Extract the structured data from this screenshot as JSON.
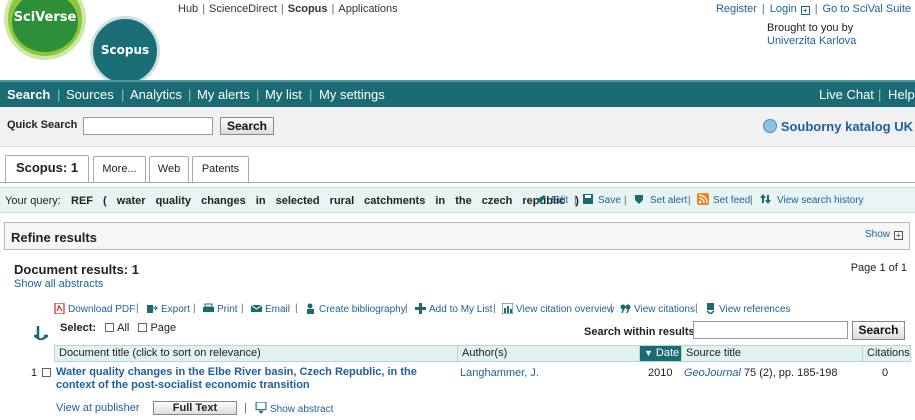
{
  "logos": {
    "sciverse": "SciVerse",
    "scopus": "Scopus"
  },
  "topnav": {
    "hub": "Hub",
    "sciencedirect": "ScienceDirect",
    "scopus": "Scopus",
    "applications": "Applications"
  },
  "toplinks": {
    "register": "Register",
    "login": "Login",
    "login_icon": "+",
    "scival": "Go to SciVal Suite"
  },
  "brought": {
    "line1": "Brought to you by",
    "line2": "Univerzita Karlova"
  },
  "mainnav": {
    "items": [
      "Search",
      "Sources",
      "Analytics",
      "My alerts",
      "My list",
      "My settings"
    ],
    "live_chat": "Live Chat",
    "help": "Help"
  },
  "quick_search": {
    "label": "Quick Search",
    "value": "",
    "button": "Search"
  },
  "katalog": "Souborny katalog UK",
  "tabs": [
    "Scopus: 1",
    "More...",
    "Web",
    "Patents"
  ],
  "query": {
    "label": "Your query:",
    "text": "REF ( water quality changes in selected rural catchments in the czech republic )",
    "edit": "Edit",
    "save": "Save",
    "set_alert": "Set alert",
    "set_feed": "Set feed",
    "history": "View search history"
  },
  "refine": {
    "title": "Refine results",
    "show": "Show",
    "show_icon": "+"
  },
  "results": {
    "title": "Document results: 1",
    "show_all": "Show all abstracts",
    "page": "Page  1 of 1"
  },
  "toolbar": {
    "download_pdf": "Download PDF",
    "export": "Export",
    "print": "Print",
    "email": "Email",
    "bibliography": "Create bibliography",
    "add_list": "Add to My List",
    "citation_overview": "View citation overview",
    "citations": "View citations",
    "references": "View references"
  },
  "select": {
    "label": "Select:",
    "all": "All",
    "page": "Page"
  },
  "search_within": {
    "label": "Search within results",
    "value": "",
    "button": "Search"
  },
  "table": {
    "headers": [
      "Document title (click to sort on relevance)",
      "Author(s)",
      "Date",
      "Source title",
      "Citations"
    ],
    "date_sort_icon": "▼",
    "rows": [
      {
        "num": "1",
        "title": "Water quality changes in the Elbe River basin, Czech Republic, in the context of the post-socialist economic transition",
        "author": "Langhammer, J.",
        "year": "2010",
        "journal": "GeoJournal",
        "source_rest": "75 (2), pp. 185-198",
        "citations": "0"
      }
    ]
  },
  "row_links": {
    "publisher": "View at publisher",
    "full_text": "Full Text",
    "abstract": "Show abstract"
  },
  "colors": {
    "nav": "#1a6b74",
    "link": "#1f5f9e",
    "query_bg": "#e8f3f3",
    "sciverse_green": "#2f8f38"
  }
}
